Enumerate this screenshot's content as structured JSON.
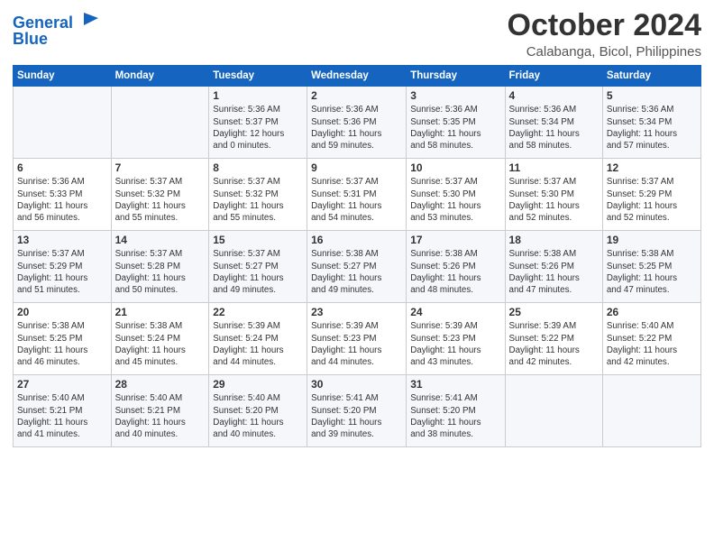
{
  "header": {
    "logo_line1": "General",
    "logo_line2": "Blue",
    "month": "October 2024",
    "location": "Calabanga, Bicol, Philippines"
  },
  "days_of_week": [
    "Sunday",
    "Monday",
    "Tuesday",
    "Wednesday",
    "Thursday",
    "Friday",
    "Saturday"
  ],
  "weeks": [
    [
      {
        "day": "",
        "info": ""
      },
      {
        "day": "",
        "info": ""
      },
      {
        "day": "1",
        "info": "Sunrise: 5:36 AM\nSunset: 5:37 PM\nDaylight: 12 hours\nand 0 minutes."
      },
      {
        "day": "2",
        "info": "Sunrise: 5:36 AM\nSunset: 5:36 PM\nDaylight: 11 hours\nand 59 minutes."
      },
      {
        "day": "3",
        "info": "Sunrise: 5:36 AM\nSunset: 5:35 PM\nDaylight: 11 hours\nand 58 minutes."
      },
      {
        "day": "4",
        "info": "Sunrise: 5:36 AM\nSunset: 5:34 PM\nDaylight: 11 hours\nand 58 minutes."
      },
      {
        "day": "5",
        "info": "Sunrise: 5:36 AM\nSunset: 5:34 PM\nDaylight: 11 hours\nand 57 minutes."
      }
    ],
    [
      {
        "day": "6",
        "info": "Sunrise: 5:36 AM\nSunset: 5:33 PM\nDaylight: 11 hours\nand 56 minutes."
      },
      {
        "day": "7",
        "info": "Sunrise: 5:37 AM\nSunset: 5:32 PM\nDaylight: 11 hours\nand 55 minutes."
      },
      {
        "day": "8",
        "info": "Sunrise: 5:37 AM\nSunset: 5:32 PM\nDaylight: 11 hours\nand 55 minutes."
      },
      {
        "day": "9",
        "info": "Sunrise: 5:37 AM\nSunset: 5:31 PM\nDaylight: 11 hours\nand 54 minutes."
      },
      {
        "day": "10",
        "info": "Sunrise: 5:37 AM\nSunset: 5:30 PM\nDaylight: 11 hours\nand 53 minutes."
      },
      {
        "day": "11",
        "info": "Sunrise: 5:37 AM\nSunset: 5:30 PM\nDaylight: 11 hours\nand 52 minutes."
      },
      {
        "day": "12",
        "info": "Sunrise: 5:37 AM\nSunset: 5:29 PM\nDaylight: 11 hours\nand 52 minutes."
      }
    ],
    [
      {
        "day": "13",
        "info": "Sunrise: 5:37 AM\nSunset: 5:29 PM\nDaylight: 11 hours\nand 51 minutes."
      },
      {
        "day": "14",
        "info": "Sunrise: 5:37 AM\nSunset: 5:28 PM\nDaylight: 11 hours\nand 50 minutes."
      },
      {
        "day": "15",
        "info": "Sunrise: 5:37 AM\nSunset: 5:27 PM\nDaylight: 11 hours\nand 49 minutes."
      },
      {
        "day": "16",
        "info": "Sunrise: 5:38 AM\nSunset: 5:27 PM\nDaylight: 11 hours\nand 49 minutes."
      },
      {
        "day": "17",
        "info": "Sunrise: 5:38 AM\nSunset: 5:26 PM\nDaylight: 11 hours\nand 48 minutes."
      },
      {
        "day": "18",
        "info": "Sunrise: 5:38 AM\nSunset: 5:26 PM\nDaylight: 11 hours\nand 47 minutes."
      },
      {
        "day": "19",
        "info": "Sunrise: 5:38 AM\nSunset: 5:25 PM\nDaylight: 11 hours\nand 47 minutes."
      }
    ],
    [
      {
        "day": "20",
        "info": "Sunrise: 5:38 AM\nSunset: 5:25 PM\nDaylight: 11 hours\nand 46 minutes."
      },
      {
        "day": "21",
        "info": "Sunrise: 5:38 AM\nSunset: 5:24 PM\nDaylight: 11 hours\nand 45 minutes."
      },
      {
        "day": "22",
        "info": "Sunrise: 5:39 AM\nSunset: 5:24 PM\nDaylight: 11 hours\nand 44 minutes."
      },
      {
        "day": "23",
        "info": "Sunrise: 5:39 AM\nSunset: 5:23 PM\nDaylight: 11 hours\nand 44 minutes."
      },
      {
        "day": "24",
        "info": "Sunrise: 5:39 AM\nSunset: 5:23 PM\nDaylight: 11 hours\nand 43 minutes."
      },
      {
        "day": "25",
        "info": "Sunrise: 5:39 AM\nSunset: 5:22 PM\nDaylight: 11 hours\nand 42 minutes."
      },
      {
        "day": "26",
        "info": "Sunrise: 5:40 AM\nSunset: 5:22 PM\nDaylight: 11 hours\nand 42 minutes."
      }
    ],
    [
      {
        "day": "27",
        "info": "Sunrise: 5:40 AM\nSunset: 5:21 PM\nDaylight: 11 hours\nand 41 minutes."
      },
      {
        "day": "28",
        "info": "Sunrise: 5:40 AM\nSunset: 5:21 PM\nDaylight: 11 hours\nand 40 minutes."
      },
      {
        "day": "29",
        "info": "Sunrise: 5:40 AM\nSunset: 5:20 PM\nDaylight: 11 hours\nand 40 minutes."
      },
      {
        "day": "30",
        "info": "Sunrise: 5:41 AM\nSunset: 5:20 PM\nDaylight: 11 hours\nand 39 minutes."
      },
      {
        "day": "31",
        "info": "Sunrise: 5:41 AM\nSunset: 5:20 PM\nDaylight: 11 hours\nand 38 minutes."
      },
      {
        "day": "",
        "info": ""
      },
      {
        "day": "",
        "info": ""
      }
    ]
  ]
}
